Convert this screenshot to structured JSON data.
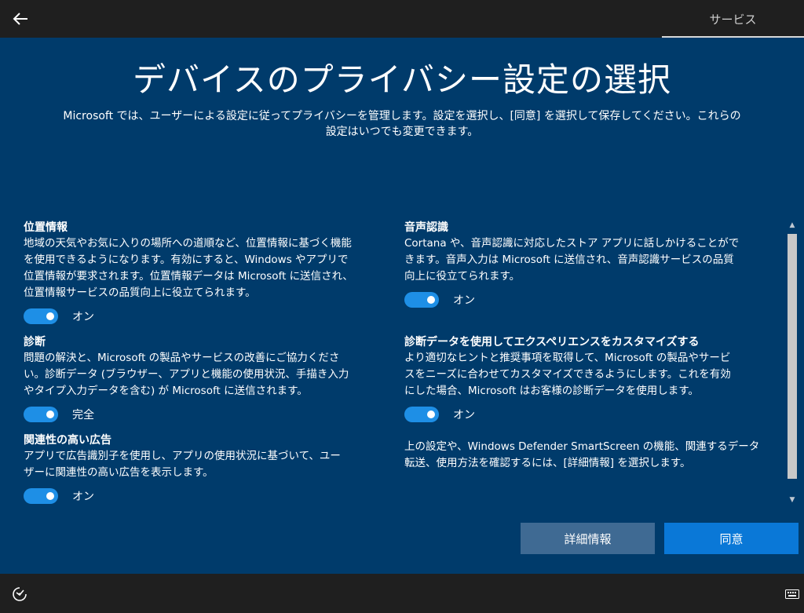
{
  "header": {
    "tab_label": "サービス"
  },
  "main": {
    "title": "デバイスのプライバシー設定の選択",
    "subtitle_line1": "Microsoft では、ユーザーによる設定に従ってプライバシーを管理します。設定を選択し、[同意] を選択して保存してください。これらの",
    "subtitle_line2": "設定はいつでも変更できます。"
  },
  "settings": {
    "location": {
      "title": "位置情報",
      "desc": [
        "地域の天気やお気に入りの場所への道順など、位置情報に基づく機能",
        "を使用できるようになります。有効にすると、Windows やアプリで",
        "位置情報が要求されます。位置情報データは Microsoft に送信され、",
        "位置情報サービスの品質向上に役立てられます。"
      ],
      "state": "オン"
    },
    "diagnostics": {
      "title": "診断",
      "desc": [
        "問題の解決と、Microsoft の製品やサービスの改善にご協力くださ",
        "い。診断データ (ブラウザー、アプリと機能の使用状況、手描き入力",
        "やタイプ入力データを含む) が Microsoft に送信されます。"
      ],
      "state": "完全"
    },
    "ads": {
      "title": "関連性の高い広告",
      "desc": [
        "アプリで広告識別子を使用し、アプリの使用状況に基づいて、ユー",
        "ザーに関連性の高い広告を表示します。"
      ],
      "state": "オン"
    },
    "speech": {
      "title": "音声認識",
      "desc": [
        "Cortana や、音声認識に対応したストア アプリに話しかけることがで",
        "きます。音声入力は Microsoft に送信され、音声認識サービスの品質",
        "向上に役立てられます。"
      ],
      "state": "オン"
    },
    "tailored": {
      "title": "診断データを使用してエクスペリエンスをカスタマイズする",
      "desc": [
        "より適切なヒントと推奨事項を取得して、Microsoft の製品やサービ",
        "スをニーズに合わせてカスタマイズできるようにします。これを有効",
        "にした場合、Microsoft はお客様の診断データを使用します。"
      ],
      "state": "オン"
    },
    "footer_note": [
      "上の設定や、Windows Defender SmartScreen の機能、関連するデータ",
      "転送、使用方法を確認するには、[詳細情報] を選択します。"
    ]
  },
  "buttons": {
    "details": "詳細情報",
    "agree": "同意"
  },
  "colors": {
    "background": "#003b6b",
    "toggle_on": "#1e8fe6",
    "agree_button": "#0a78d7",
    "details_button": "#3f6a93",
    "bars": "#1f1f1f"
  },
  "icons": {
    "back": "back-arrow-icon",
    "accessibility": "ease-of-access-icon",
    "keyboard": "keyboard-icon"
  }
}
